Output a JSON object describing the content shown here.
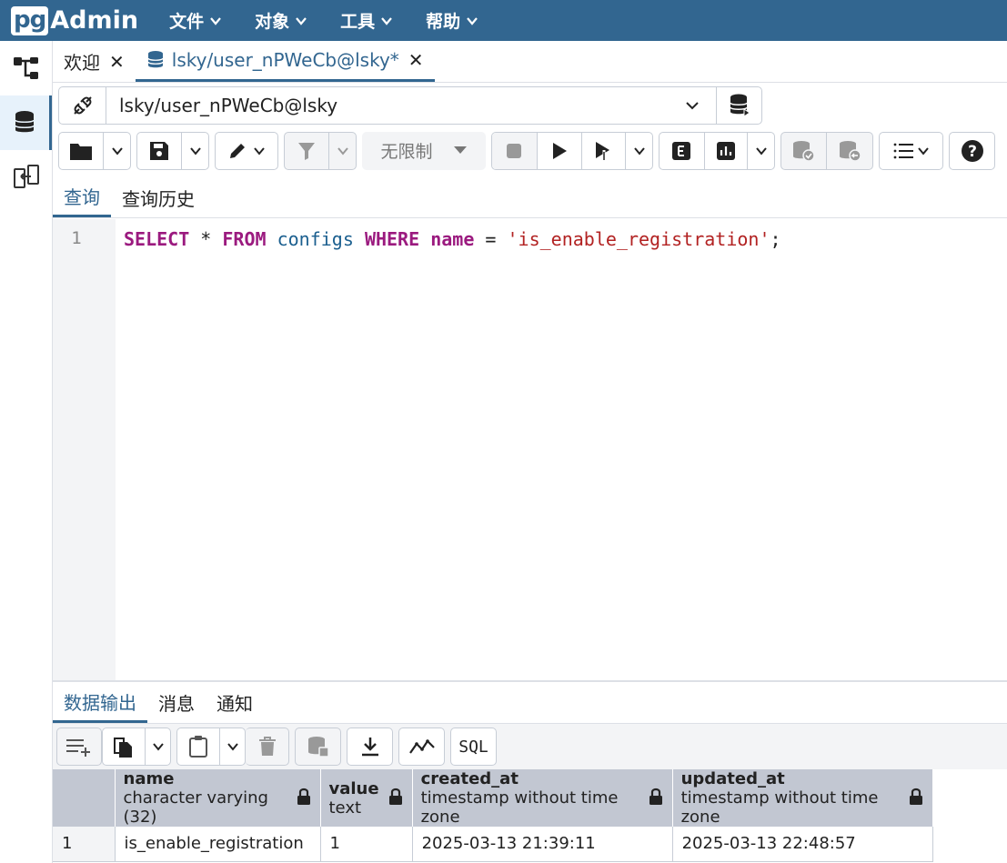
{
  "app": {
    "logo_pg": "pg",
    "logo_admin": "Admin"
  },
  "menu": [
    {
      "label": "文件"
    },
    {
      "label": "对象"
    },
    {
      "label": "工具"
    },
    {
      "label": "帮助"
    }
  ],
  "tabs": {
    "welcome": "欢迎",
    "query": "lsky/user_nPWeCb@lsky*"
  },
  "connection": {
    "label": "lsky/user_nPWeCb@lsky"
  },
  "toolbar": {
    "limit_label": "无限制"
  },
  "query_tabs": {
    "query": "查询",
    "history": "查询历史"
  },
  "editor": {
    "line_number": "1",
    "tokens": {
      "select": "SELECT",
      "star": " * ",
      "from": "FROM",
      "table": "configs",
      "where": "WHERE",
      "column": "name",
      "eq": " = ",
      "literal": "'is_enable_registration'",
      "semi": ";"
    }
  },
  "result_tabs": {
    "data_output": "数据输出",
    "messages": "消息",
    "notifications": "通知"
  },
  "result_toolbar": {
    "sql_label": "SQL"
  },
  "grid": {
    "columns": [
      {
        "name": "name",
        "type": "character varying (32)"
      },
      {
        "name": "value",
        "type": "text"
      },
      {
        "name": "created_at",
        "type": "timestamp without time zone"
      },
      {
        "name": "updated_at",
        "type": "timestamp without time zone"
      }
    ],
    "rows": [
      {
        "num": "1",
        "name": "is_enable_registration",
        "value": "1",
        "created_at": "2025-03-13 21:39:11",
        "updated_at": "2025-03-13 22:48:57"
      }
    ]
  },
  "colors": {
    "brand": "#326690",
    "header_bg": "#c2c7d2",
    "keyword": "#9b1a7f",
    "string": "#b22222"
  }
}
